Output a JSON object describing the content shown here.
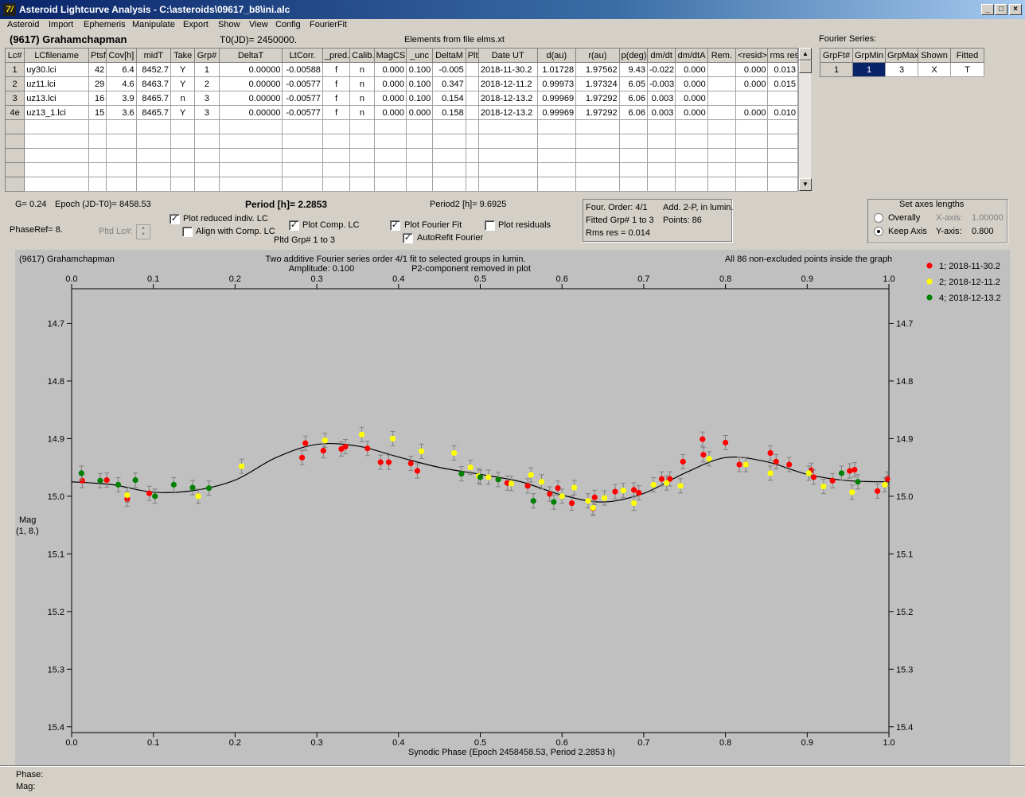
{
  "window": {
    "title": "Asteroid Lightcurve Analysis - C:\\asteroids\\09617_b8\\ini.alc",
    "app_icon": "7/",
    "minimize": "_",
    "maximize": "□",
    "close": "×"
  },
  "menu": [
    "Asteroid",
    "Import",
    "Ephemeris",
    "Manipulate",
    "Export",
    "Show",
    "View",
    "Config",
    "FourierFit"
  ],
  "header": {
    "asteroid": "(9617) Grahamchapman",
    "t0": "T0(JD)= 2450000.",
    "elements": "Elements from file elms.xt",
    "fourier_label": "Fourier Series:"
  },
  "table": {
    "columns": [
      "Lc#",
      "LCfilename",
      "Ptsf",
      "Cov[h]",
      "midT",
      "Take",
      "Grp#",
      "DeltaT",
      "LtCorr.",
      "_pred.",
      "Calib.",
      "MagCS",
      "_unc",
      "DeltaM",
      "Plt",
      "Date UT",
      "d(au)",
      "r(au)",
      "p(deg)",
      "dm/dt",
      "dm/dtA",
      "Rem.",
      "<resid>",
      "rms res"
    ],
    "rows": [
      [
        "1",
        "uy30.lci",
        "42",
        "6.4",
        "8452.7",
        "Y",
        "1",
        "0.00000",
        "-0.00588",
        "f",
        "n",
        "0.000",
        "0.100",
        "-0.005",
        "",
        "2018-11-30.2",
        "1.01728",
        "1.97562",
        "9.43",
        "-0.022",
        "0.000",
        "",
        "0.000",
        "0.013"
      ],
      [
        "2",
        "uz11.lci",
        "29",
        "4.6",
        "8463.7",
        "Y",
        "2",
        "0.00000",
        "-0.00577",
        "f",
        "n",
        "0.000",
        "0.100",
        "0.347",
        "",
        "2018-12-11.2",
        "0.99973",
        "1.97324",
        "6.05",
        "-0.003",
        "0.000",
        "",
        "0.000",
        "0.015"
      ],
      [
        "3",
        "uz13.lci",
        "16",
        "3.9",
        "8465.7",
        "n",
        "3",
        "0.00000",
        "-0.00577",
        "f",
        "n",
        "0.000",
        "0.100",
        "0.154",
        "",
        "2018-12-13.2",
        "0.99969",
        "1.97292",
        "6.06",
        "0.003",
        "0.000",
        "",
        "",
        ""
      ],
      [
        "4e",
        "uz13_1.lci",
        "15",
        "3.6",
        "8465.7",
        "Y",
        "3",
        "0.00000",
        "-0.00577",
        "f",
        "n",
        "0.000",
        "0.000",
        "0.158",
        "",
        "2018-12-13.2",
        "0.99969",
        "1.97292",
        "6.06",
        "0.003",
        "0.000",
        "",
        "0.000",
        "0.010"
      ]
    ]
  },
  "fourier_table": {
    "columns": [
      "GrpFt#",
      "GrpMin",
      "GrpMax",
      "Shown",
      "Fitted"
    ],
    "row": [
      "1",
      "1",
      "3",
      "X",
      "T"
    ]
  },
  "info": {
    "g": "G= 0.24",
    "epoch": "Epoch (JD-T0)= 8458.53",
    "period": "Period [h]= 2.2853",
    "period2": "Period2 [h]= 9.6925",
    "phaseref": "PhaseRef= 8.",
    "pltd_lc": "Pltd Lc#:",
    "plot_reduced": "Plot reduced indiv. LC",
    "align": "Align with Comp. LC",
    "plot_comp": "Plot Comp. LC",
    "pltd_grp": "Pltd Grp#  1   to   3",
    "plot_fourier": "Plot Fourier Fit",
    "autorefit": "AutoRefit Fourier",
    "plot_residuals": "Plot residuals",
    "four_order": "Four. Order:  4/1",
    "add2p": "Add. 2-P, in lumin.",
    "fitted_grp": "Fitted Grp# 1 to 3",
    "points": "Points: 86",
    "rms": "Rms res      = 0.014",
    "axes_title": "Set axes lengths",
    "overally": "Overally",
    "keep_axis": "Keep Axis",
    "xaxis_label": "X-axis:",
    "xaxis_val": "1.00000",
    "yaxis_label": "Y-axis:",
    "yaxis_val": "0.800",
    "checks": {
      "plot_reduced": true,
      "align": false,
      "plot_comp": true,
      "plot_fourier": true,
      "autorefit": true,
      "plot_residuals": false
    }
  },
  "status": {
    "phase": "Phase:",
    "mag": "Mag:"
  },
  "chart_data": {
    "type": "scatter",
    "title_left": "(9617) Grahamchapman",
    "title_center1": "Two additive Fourier series order 4/1 fit to selected groups in lumin.",
    "title_center2": "Amplitude: 0.100",
    "title_center3": "P2-component removed in plot",
    "title_right": "All 86 non-excluded points inside the graph",
    "xlabel": "Synodic Phase (Epoch 2458458.53, Period 2.2853 h)",
    "ylabel1": "Mag",
    "ylabel2": "(1, 8.)",
    "xlim": [
      0,
      1
    ],
    "ylim": [
      14.64,
      15.41
    ],
    "y_reversed": true,
    "xticks": [
      "0.0",
      "0.1",
      "0.2",
      "0.3",
      "0.4",
      "0.5",
      "0.6",
      "0.7",
      "0.8",
      "0.9",
      "1.0"
    ],
    "yticks": [
      "14.7",
      "14.8",
      "14.9",
      "15.0",
      "15.1",
      "15.2",
      "15.3",
      "15.4"
    ],
    "legend_position": "right",
    "series": [
      {
        "name": "1; 2018-11-30.2",
        "color": "#ff0000",
        "points": [
          [
            0.013,
            14.973
          ],
          [
            0.043,
            14.972
          ],
          [
            0.068,
            15.005
          ],
          [
            0.095,
            14.995
          ],
          [
            0.282,
            14.933
          ],
          [
            0.286,
            14.908
          ],
          [
            0.308,
            14.921
          ],
          [
            0.33,
            14.918
          ],
          [
            0.335,
            14.914
          ],
          [
            0.362,
            14.917
          ],
          [
            0.378,
            14.941
          ],
          [
            0.388,
            14.941
          ],
          [
            0.415,
            14.943
          ],
          [
            0.423,
            14.956
          ],
          [
            0.533,
            14.977
          ],
          [
            0.558,
            14.982
          ],
          [
            0.585,
            14.996
          ],
          [
            0.595,
            14.986
          ],
          [
            0.612,
            15.012
          ],
          [
            0.638,
            15.021
          ],
          [
            0.64,
            15.002
          ],
          [
            0.665,
            14.992
          ],
          [
            0.688,
            14.989
          ],
          [
            0.694,
            14.994
          ],
          [
            0.722,
            14.97
          ],
          [
            0.732,
            14.97
          ],
          [
            0.748,
            14.94
          ],
          [
            0.772,
            14.901
          ],
          [
            0.773,
            14.928
          ],
          [
            0.8,
            14.907
          ],
          [
            0.817,
            14.945
          ],
          [
            0.825,
            14.945
          ],
          [
            0.855,
            14.925
          ],
          [
            0.862,
            14.94
          ],
          [
            0.878,
            14.945
          ],
          [
            0.905,
            14.955
          ],
          [
            0.908,
            14.967
          ],
          [
            0.931,
            14.973
          ],
          [
            0.952,
            14.956
          ],
          [
            0.958,
            14.954
          ],
          [
            0.986,
            14.991
          ],
          [
            0.998,
            14.97
          ]
        ]
      },
      {
        "name": "2; 2018-12-11.2",
        "color": "#ffff00",
        "points": [
          [
            0.068,
            14.998
          ],
          [
            0.155,
            15.0
          ],
          [
            0.208,
            14.948
          ],
          [
            0.31,
            14.903
          ],
          [
            0.355,
            14.893
          ],
          [
            0.393,
            14.9
          ],
          [
            0.428,
            14.922
          ],
          [
            0.468,
            14.925
          ],
          [
            0.488,
            14.95
          ],
          [
            0.498,
            14.965
          ],
          [
            0.51,
            14.967
          ],
          [
            0.538,
            14.978
          ],
          [
            0.562,
            14.963
          ],
          [
            0.575,
            14.975
          ],
          [
            0.6,
            15.0
          ],
          [
            0.615,
            14.985
          ],
          [
            0.632,
            15.008
          ],
          [
            0.638,
            15.02
          ],
          [
            0.652,
            15.003
          ],
          [
            0.675,
            14.99
          ],
          [
            0.688,
            15.012
          ],
          [
            0.712,
            14.98
          ],
          [
            0.728,
            14.977
          ],
          [
            0.745,
            14.982
          ],
          [
            0.78,
            14.935
          ],
          [
            0.825,
            14.945
          ],
          [
            0.855,
            14.96
          ],
          [
            0.902,
            14.96
          ],
          [
            0.92,
            14.983
          ],
          [
            0.955,
            14.993
          ],
          [
            0.995,
            14.98
          ]
        ]
      },
      {
        "name": "4; 2018-12-13.2",
        "color": "#008000",
        "points": [
          [
            0.012,
            14.96
          ],
          [
            0.035,
            14.973
          ],
          [
            0.057,
            14.98
          ],
          [
            0.078,
            14.972
          ],
          [
            0.102,
            15.0
          ],
          [
            0.125,
            14.98
          ],
          [
            0.148,
            14.985
          ],
          [
            0.168,
            14.986
          ],
          [
            0.477,
            14.961
          ],
          [
            0.5,
            14.967
          ],
          [
            0.522,
            14.971
          ],
          [
            0.565,
            15.008
          ],
          [
            0.59,
            15.01
          ],
          [
            0.942,
            14.96
          ],
          [
            0.962,
            14.975
          ]
        ]
      }
    ],
    "fit_curve": {
      "color": "#000000",
      "points": [
        [
          0,
          14.975
        ],
        [
          0.05,
          14.98
        ],
        [
          0.1,
          14.993
        ],
        [
          0.15,
          14.99
        ],
        [
          0.2,
          14.972
        ],
        [
          0.25,
          14.933
        ],
        [
          0.3,
          14.91
        ],
        [
          0.35,
          14.913
        ],
        [
          0.4,
          14.932
        ],
        [
          0.45,
          14.95
        ],
        [
          0.5,
          14.962
        ],
        [
          0.55,
          14.975
        ],
        [
          0.6,
          14.998
        ],
        [
          0.65,
          15.01
        ],
        [
          0.7,
          14.995
        ],
        [
          0.75,
          14.96
        ],
        [
          0.8,
          14.933
        ],
        [
          0.85,
          14.94
        ],
        [
          0.9,
          14.962
        ],
        [
          0.95,
          14.973
        ],
        [
          1.0,
          14.975
        ]
      ]
    }
  }
}
